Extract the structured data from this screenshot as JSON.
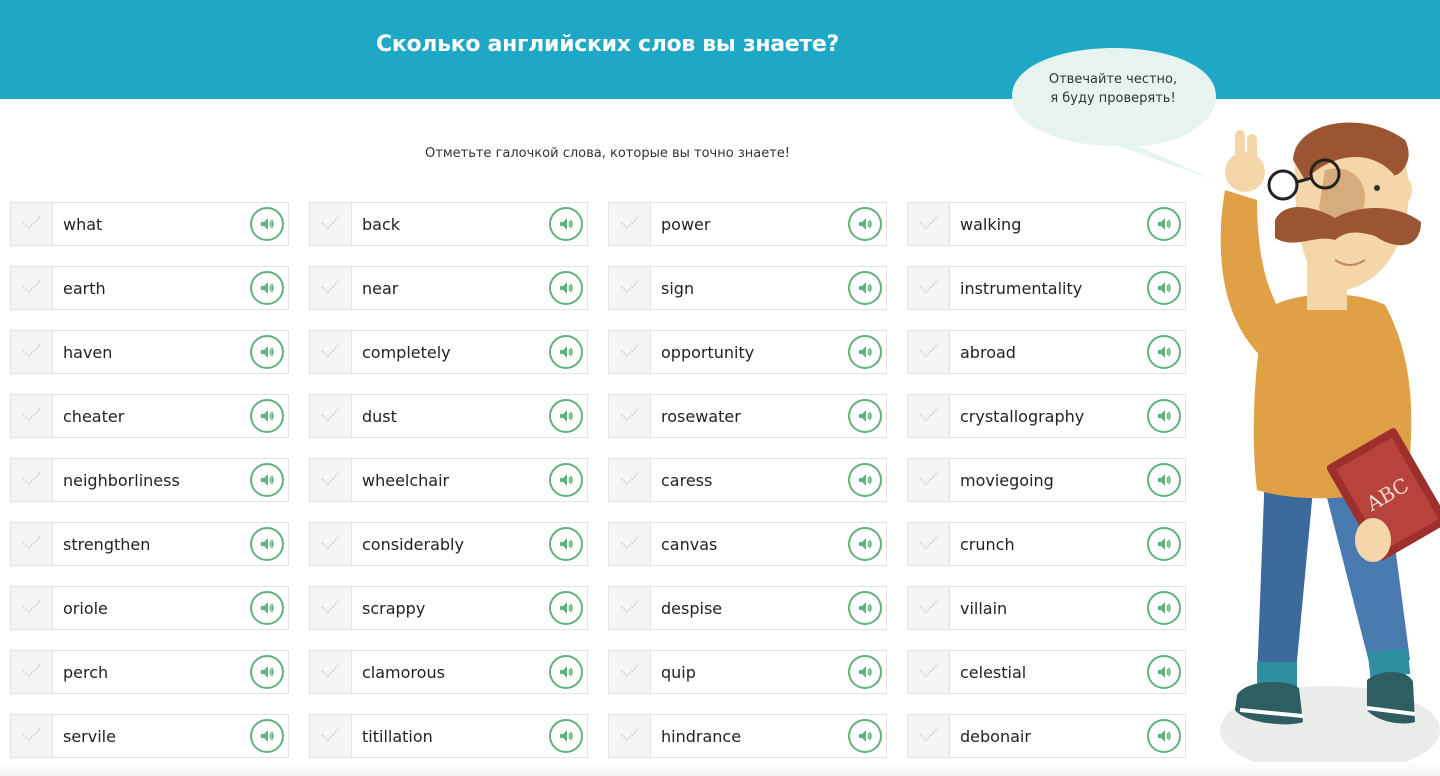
{
  "header": {
    "title": "Сколько английских слов вы знаете?"
  },
  "instructions": "Отметьте галочкой слова, которые вы точно знаете!",
  "speech_bubble": {
    "line1": "Отвечайте честно,",
    "line2": "я буду проверять!"
  },
  "mascot": {
    "book_text": "ABC"
  },
  "colors": {
    "banner": "#1ea8c6",
    "sound_accent": "#5fb47a",
    "bubble": "#e6f3ee"
  },
  "icons": {
    "checkbox": "check-icon",
    "sound": "speaker-icon"
  },
  "words": [
    "what",
    "back",
    "power",
    "walking",
    "earth",
    "near",
    "sign",
    "instrumentality",
    "haven",
    "completely",
    "opportunity",
    "abroad",
    "cheater",
    "dust",
    "rosewater",
    "crystallography",
    "neighborliness",
    "wheelchair",
    "caress",
    "moviegoing",
    "strengthen",
    "considerably",
    "canvas",
    "crunch",
    "oriole",
    "scrappy",
    "despise",
    "villain",
    "perch",
    "clamorous",
    "quip",
    "celestial",
    "servile",
    "titillation",
    "hindrance",
    "debonair"
  ]
}
